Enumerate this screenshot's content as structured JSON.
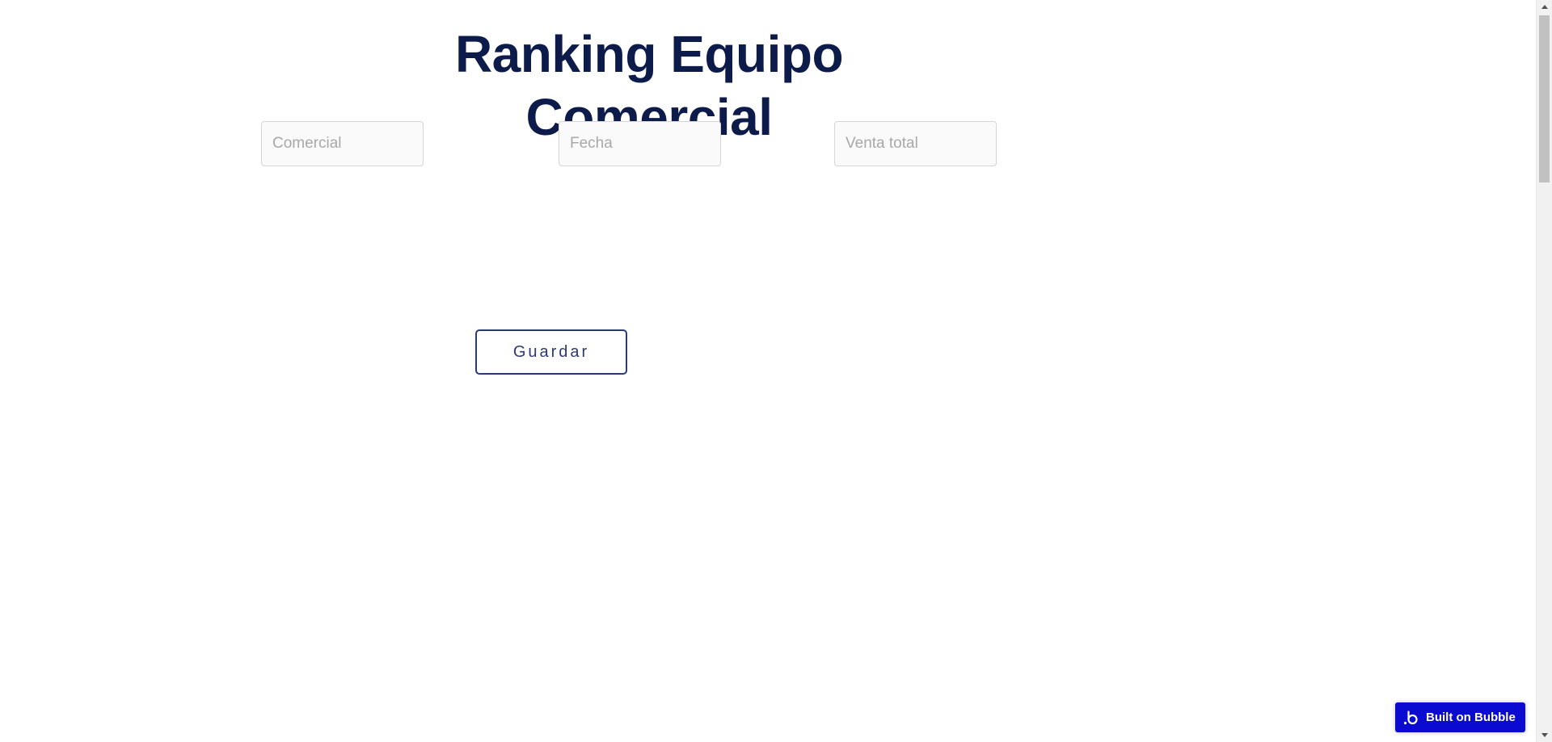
{
  "page": {
    "title": "Ranking Equipo Comercial"
  },
  "form": {
    "comercial_placeholder": "Comercial",
    "comercial_value": "",
    "fecha_placeholder": "Fecha",
    "fecha_value": "",
    "venta_placeholder": "Venta total",
    "venta_value": "",
    "save_label": "Guardar"
  },
  "badge": {
    "label": "Built on Bubble",
    "icon": "bubble-logo-icon"
  },
  "colors": {
    "title": "#0d1b4b",
    "button_border": "#2b3a73",
    "badge_bg": "#0a0ad1"
  }
}
